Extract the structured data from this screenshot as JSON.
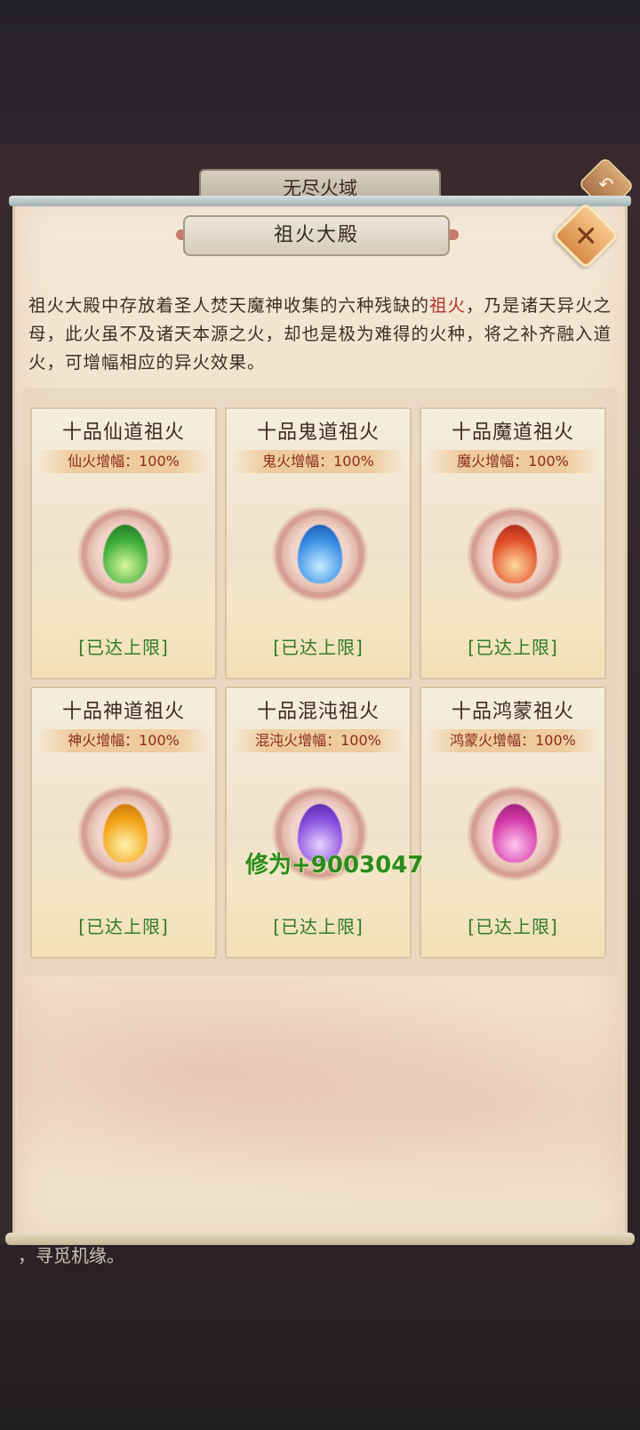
{
  "outer": {
    "title": "无尽火域",
    "back_icon": "back-arrow-icon",
    "footer_text": "，寻觅机缘。"
  },
  "panel": {
    "title": "祖火大殿",
    "close_icon": "close-x-icon",
    "description_part1": "祖火大殿中存放着圣人焚天魔神收集的六种残缺的",
    "description_highlight": "祖火",
    "description_part2": "，乃是诸天异火之母，此火虽不及诸天本源之火，却也是极为难得的火种，将之补齐融入道火，可增幅相应的异火效果。"
  },
  "cards": [
    {
      "name": "十品仙道祖火",
      "bonus": "仙火增幅：100%",
      "status": "[已达上限]",
      "flame_color": "#3fae3a"
    },
    {
      "name": "十品鬼道祖火",
      "bonus": "鬼火增幅：100%",
      "status": "[已达上限]",
      "flame_color": "#3a8fe6"
    },
    {
      "name": "十品魔道祖火",
      "bonus": "魔火增幅：100%",
      "status": "[已达上限]",
      "flame_color": "#e2532a"
    },
    {
      "name": "十品神道祖火",
      "bonus": "神火增幅：100%",
      "status": "[已达上限]",
      "flame_color": "#f3a417"
    },
    {
      "name": "十品混沌祖火",
      "bonus": "混沌火增幅：100%",
      "status": "[已达上限]",
      "flame_color": "#8a4fe0"
    },
    {
      "name": "十品鸿蒙祖火",
      "bonus": "鸿蒙火增幅：100%",
      "status": "[已达上限]",
      "flame_color": "#d63aa8"
    }
  ],
  "floating_text": "修为+9003047",
  "colors": {
    "status_green": "#2f7a2a",
    "bonus_red": "#8a2d20",
    "highlight_red": "#b3322a"
  }
}
